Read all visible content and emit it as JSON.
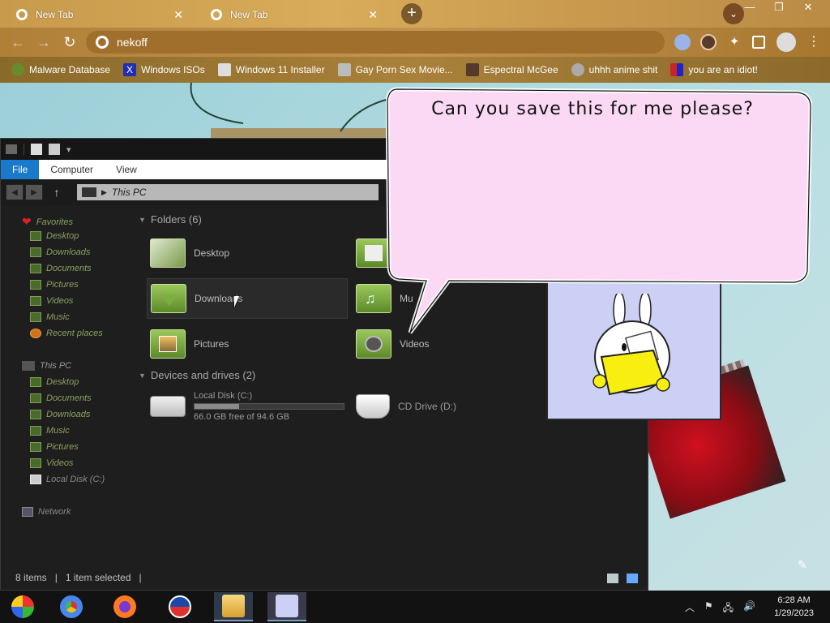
{
  "browser": {
    "tabs": [
      {
        "title": "New Tab"
      },
      {
        "title": "New Tab"
      }
    ],
    "omnibox_value": "nekoff",
    "bookmarks": [
      {
        "label": "Malware Database"
      },
      {
        "label": "Windows ISOs"
      },
      {
        "label": "Windows 11 Installer"
      },
      {
        "label": "Gay Porn Sex Movie..."
      },
      {
        "label": "Espectral McGee"
      },
      {
        "label": "uhhh anime shit"
      },
      {
        "label": "you are an idiot!"
      }
    ]
  },
  "explorer": {
    "ribbon_tabs": [
      "File",
      "Computer",
      "View"
    ],
    "address_path": "This PC",
    "sidebar": {
      "favorites_header": "Favorites",
      "favorites": [
        "Desktop",
        "Downloads",
        "Documents",
        "Pictures",
        "Videos",
        "Music",
        "Recent places"
      ],
      "thispc_header": "This PC",
      "thispc": [
        "Desktop",
        "Documents",
        "Downloads",
        "Music",
        "Pictures",
        "Videos",
        "Local Disk (C:)"
      ],
      "network": "Network"
    },
    "folders_header": "Folders (6)",
    "folders": [
      "Desktop",
      "Downloads",
      "Pictures",
      "Videos",
      "Mu"
    ],
    "drives_header": "Devices and drives (2)",
    "drives": [
      {
        "name": "Local Disk (C:)",
        "free": "66.0 GB free of 94.6 GB",
        "used_fraction": 0.3
      },
      {
        "name": "CD Drive (D:)"
      }
    ],
    "status": {
      "items": "8 items",
      "selected": "1 item selected"
    }
  },
  "popup": {
    "speech": "Can you save this for me please?"
  },
  "taskbar": {
    "time": "6:28 AM",
    "date": "1/29/2023"
  },
  "colors": {
    "explorer_bg": "#1e1e1e",
    "accent": "#1979ca",
    "bubble_fill": "#fbd9f4"
  }
}
